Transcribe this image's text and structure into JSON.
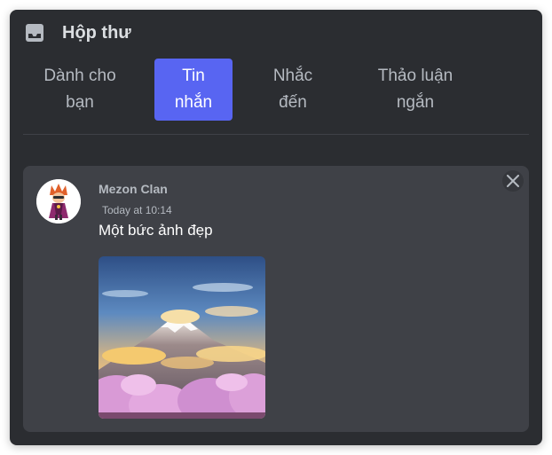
{
  "header": {
    "title": "Hộp thư",
    "icon": "inbox-icon"
  },
  "tabs": [
    {
      "line1": "Dành cho",
      "line2": "bạn",
      "active": false
    },
    {
      "line1": "Tin",
      "line2": "nhắn",
      "active": true
    },
    {
      "line1": "Nhắc",
      "line2": "đến",
      "active": false
    },
    {
      "line1": "Thảo luận",
      "line2": "ngắn",
      "active": false
    }
  ],
  "notification": {
    "author": "Mezon Clan",
    "timestamp": "Today at 10:14",
    "message": "Một bức ảnh đẹp",
    "close_icon": "close-icon",
    "attachment": "mountain-photo"
  },
  "colors": {
    "panel_bg": "#2b2d31",
    "card_bg": "#3f4147",
    "accent": "#5865f2",
    "text_muted": "#b5bac1"
  }
}
